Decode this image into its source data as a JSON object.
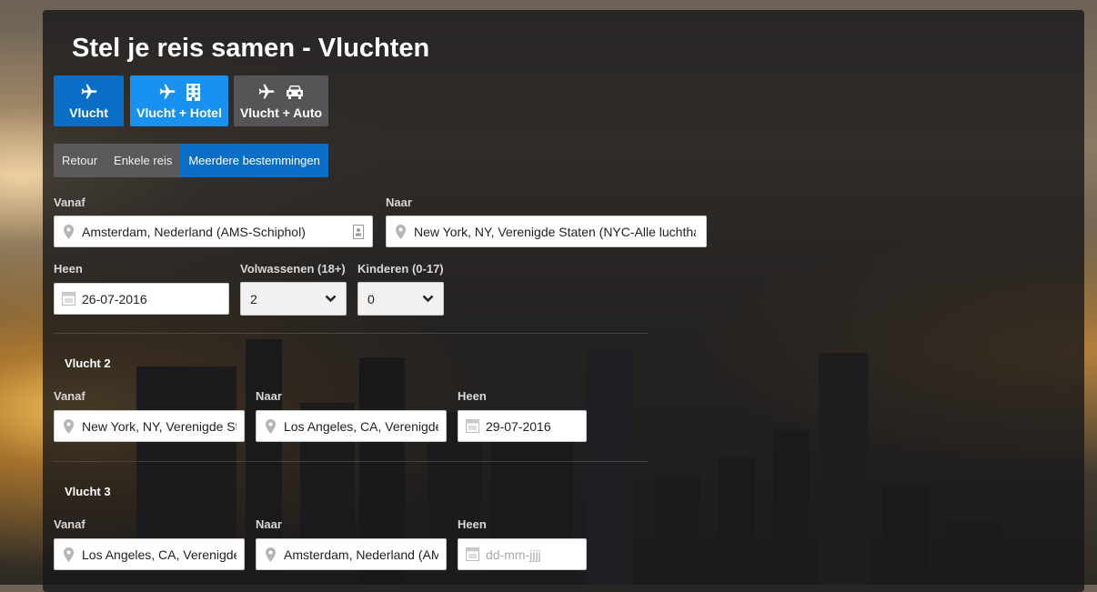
{
  "page": {
    "title": "Stel je reis samen - Vluchten"
  },
  "product_buttons": [
    {
      "label": "Vlucht",
      "icons": [
        "plane-icon"
      ]
    },
    {
      "label": "Vlucht + Hotel",
      "icons": [
        "plane-icon",
        "building-icon"
      ]
    },
    {
      "label": "Vlucht + Auto",
      "icons": [
        "plane-icon",
        "car-icon"
      ]
    }
  ],
  "trip_types": [
    {
      "label": "Retour",
      "active": false
    },
    {
      "label": "Enkele reis",
      "active": false
    },
    {
      "label": "Meerdere bestemmingen",
      "active": true
    }
  ],
  "flight1": {
    "from_label": "Vanaf",
    "from_value": "Amsterdam, Nederland (AMS-Schiphol)",
    "to_label": "Naar",
    "to_value": "New York, NY, Verenigde Staten (NYC-Alle luchthavens)",
    "depart_label": "Heen",
    "depart_value": "26-07-2016",
    "adults_label": "Volwassenen (18+)",
    "adults_value": "2",
    "children_label": "Kinderen (0-17)",
    "children_value": "0"
  },
  "flight2": {
    "heading": "Vlucht 2",
    "from_label": "Vanaf",
    "from_value": "New York, NY, Verenigde Staten",
    "to_label": "Naar",
    "to_value": "Los Angeles, CA, Verenigde Staten",
    "depart_label": "Heen",
    "depart_value": "29-07-2016"
  },
  "flight3": {
    "heading": "Vlucht 3",
    "from_label": "Vanaf",
    "from_value": "Los Angeles, CA, Verenigde Staten",
    "to_label": "Naar",
    "to_value": "Amsterdam, Nederland (AMS-Schiphol)",
    "depart_label": "Heen",
    "depart_placeholder": "dd-mm-jjjj"
  },
  "colors": {
    "accent": "#0b6ec6",
    "accent_light": "#1991f0",
    "panel": "#18181a"
  }
}
